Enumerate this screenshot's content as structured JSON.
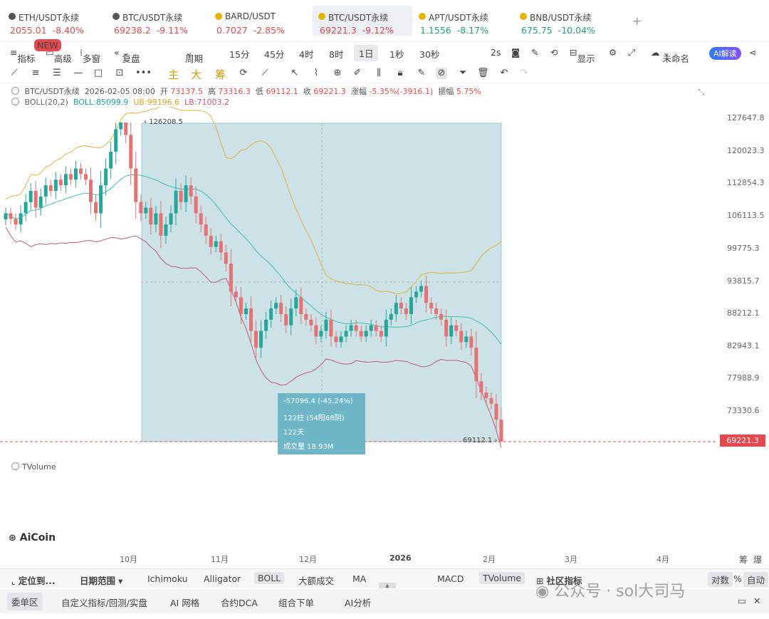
{
  "tickers": [
    {
      "name": "ETH/USDT永续",
      "price": "2055.01",
      "change": "-8.40%",
      "color": "red",
      "icon": "eth-icon"
    },
    {
      "name": "BTC/USDT永续",
      "price": "69238.2",
      "change": "-9.11%",
      "color": "red",
      "icon": "btc-icon"
    },
    {
      "name": "BARD/USDT",
      "price": "0.7027",
      "change": "-2.85%",
      "color": "red",
      "icon": "bard-icon"
    },
    {
      "name": "BTC/USDT永续",
      "price": "69221.3",
      "change": "-9.12%",
      "color": "red",
      "icon": "btc-icon"
    },
    {
      "name": "APT/USDT永续",
      "price": "1.1556",
      "change": "-8.17%",
      "color": "green",
      "icon": "apt-icon"
    },
    {
      "name": "BNB/USDT永续",
      "price": "675.75",
      "change": "-10.04%",
      "color": "green",
      "icon": "bnb-icon"
    }
  ],
  "new_badge": "NEW",
  "toolbar": {
    "indicator": "指标",
    "advanced": "高级",
    "multi": "多窗",
    "replay": "复盘",
    "period": "周期",
    "intervals": [
      "15分",
      "45分",
      "4时",
      "8时",
      "1日",
      "1秒",
      "30秒"
    ],
    "refresh": "2s",
    "display": "显示",
    "unnamed": "未命名",
    "ai": "AI解读"
  },
  "drawing_tools": {
    "main": "主",
    "big": "大",
    "chip": "筹"
  },
  "info": {
    "symbol": "BTC/USDT永续",
    "date": "2026-02-05 08:00",
    "open_label": "开",
    "open": "73137.5",
    "high_label": "高",
    "high": "73316.3",
    "low_label": "低",
    "low": "69112.1",
    "close_label": "收",
    "close": "69221.3",
    "chg_label": "涨幅",
    "chg": "-5.35%(-3916.1)",
    "amp_label": "振幅",
    "amp": "5.75%"
  },
  "boll": {
    "label": "BOLL(20,2)",
    "boll": "BOLL:85099.9",
    "ub": "UB:99196.6",
    "lb": "LB:71003.2"
  },
  "tvolume": "TVolume",
  "measure": {
    "line1": "-57096.4 (-45.24%)",
    "line2": "122柱 (54阳68阴)",
    "line3": "122天",
    "line4": "成交量 18.93M"
  },
  "annotations": {
    "high": "126208.5",
    "low": "69112.1"
  },
  "current_price": "69221.3",
  "colors": {
    "up": "#26a69a",
    "down": "#e57373",
    "mid": "#3cc0b0",
    "ub": "#e0b43c",
    "lb": "#c2567f",
    "box": "#c7dfe4",
    "price_line": "#e5484d"
  },
  "chart_data": {
    "type": "candlestick",
    "y_ticks": [
      "127647.8",
      "120023.3",
      "112854.3",
      "106113.5",
      "99775.3",
      "93815.7",
      "88212.1",
      "82943.1",
      "77988.9",
      "73330.6"
    ],
    "x_ticks": [
      "10月",
      "11月",
      "12月",
      "2026",
      "2月",
      "3月",
      "4月"
    ],
    "ylim": [
      69112.1,
      126208.5
    ],
    "series_close": [
      110000,
      109000,
      108000,
      110000,
      112000,
      114000,
      111000,
      113000,
      115000,
      114000,
      116000,
      115000,
      117000,
      116000,
      118000,
      117000,
      116000,
      112000,
      110000,
      115000,
      118000,
      121000,
      125000,
      126208.5,
      124000,
      118000,
      112000,
      110000,
      111000,
      108000,
      110000,
      106000,
      108000,
      110000,
      114000,
      112000,
      115000,
      113000,
      110000,
      108000,
      106000,
      104000,
      105000,
      103000,
      101000,
      96000,
      95000,
      92000,
      93000,
      89000,
      86000,
      89000,
      91000,
      93000,
      94000,
      92000,
      90000,
      93000,
      95000,
      92000,
      91000,
      90000,
      88000,
      89000,
      91000,
      88000,
      87000,
      88000,
      89000,
      90000,
      89000,
      88000,
      89000,
      90000,
      89000,
      88000,
      91000,
      92000,
      94000,
      93000,
      92000,
      95000,
      96000,
      97000,
      94000,
      93000,
      92000,
      91000,
      88000,
      90000,
      89000,
      87000,
      88000,
      86000,
      80000,
      78000,
      77000,
      76000,
      73137.5,
      69221.3
    ]
  },
  "bottom1": {
    "locate": "定位到...",
    "range": "日期范围",
    "inds": [
      "Ichimoku",
      "Alligator",
      "BOLL",
      "大额成交",
      "MA",
      "MACD",
      "TVolume"
    ],
    "community": "社区指标",
    "log": "对数",
    "pct": "%",
    "auto": "自动"
  },
  "bottom2": [
    "委单区",
    "自定义指标/回测/实盘",
    "AI 网格",
    "合约DCA",
    "组合下单",
    "AI分析"
  ],
  "watermark": "公众号 · sol大司马",
  "logo": "AiCoin"
}
